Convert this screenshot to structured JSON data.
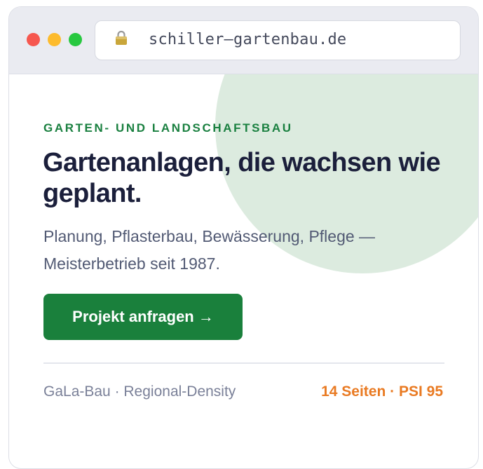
{
  "browser": {
    "url": "schiller–gartenbau.de",
    "traffic_lights": [
      "close",
      "minimize",
      "maximize"
    ],
    "lock_icon": "lock-icon"
  },
  "hero": {
    "eyebrow": "GARTEN- UND LANDSCHAFTSBAU",
    "headline": "Gartenanlagen, die wachsen wie geplant.",
    "subline": "Planung, Pflasterbau, Bewässerung, Pflege — Meisterbetrieb seit 1987.",
    "cta_label": "Projekt anfragen →"
  },
  "footer": {
    "left": "GaLa-Bau · Regional-Density",
    "right": "14 Seiten · PSI 95"
  },
  "colors": {
    "accent_green": "#1a803c",
    "blob_green": "#dcebdf",
    "headline": "#1b1f3b",
    "meta_orange": "#e97a22"
  }
}
